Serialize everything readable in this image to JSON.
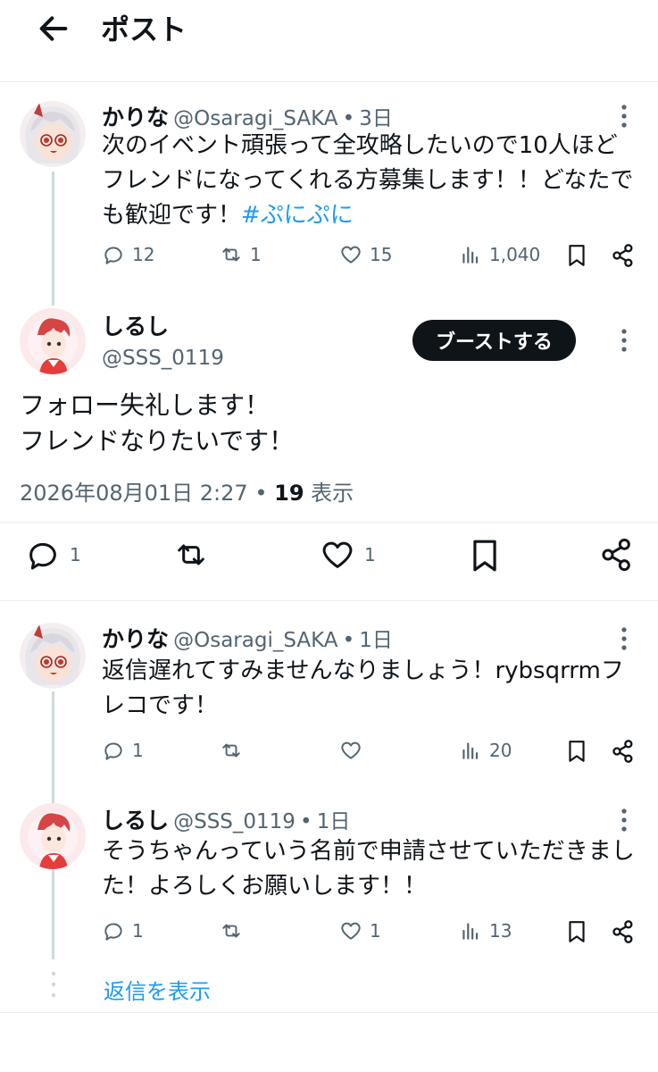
{
  "header": {
    "title": "ポスト"
  },
  "posts": [
    {
      "name": "かりな",
      "handle": "@Osaragi_SAKA",
      "dot": "•",
      "time": "3日",
      "text": "次のイベント頑張って全攻略したいので10人ほどフレンドになってくれる方募集します！！どなたでも歓迎です！",
      "hashtag": "#ぷにぷに",
      "replies": "12",
      "reposts": "1",
      "likes": "15",
      "views": "1,040"
    },
    {
      "name": "しるし",
      "handle": "@SSS_0119",
      "boost_label": "ブーストする",
      "text_line1": "フォロー失礼します！",
      "text_line2": "フレンドなりたいです！",
      "datetime": "2026年08月01日 2:27",
      "dot": "•",
      "views_count": "19",
      "views_label": "表示",
      "replies": "1",
      "likes": "1"
    },
    {
      "name": "かりな",
      "handle": "@Osaragi_SAKA",
      "dot": "•",
      "time": "1日",
      "text": "返信遅れてすみませんなりましょう！rybsqrrmフレコです！",
      "replies": "1",
      "views": "20"
    },
    {
      "name": "しるし",
      "handle": "@SSS_0119",
      "dot": "•",
      "time": "1日",
      "text": "そうちゃんっていう名前で申請させていただきました！よろしくお願いします！！",
      "replies": "1",
      "likes": "1",
      "views": "13"
    }
  ],
  "show_replies": "返信を表示",
  "colors": {
    "accent": "#1d9bf0",
    "text": "#0f1419",
    "muted": "#536471"
  }
}
